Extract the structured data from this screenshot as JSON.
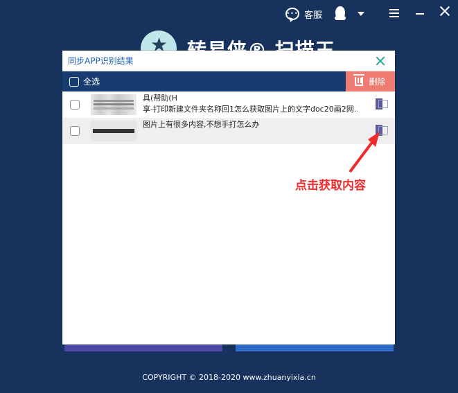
{
  "top_bar": {
    "service_label": "客服"
  },
  "brand": {
    "title": "转易侠® 扫描王"
  },
  "dialog": {
    "title": "同步APP识别结果",
    "select_all_label": "全选",
    "delete_label": "删除",
    "rows": [
      {
        "text_line1": "具(帮助(H",
        "text_line2": "享-打印新建文件夹名称回1怎么获取图片上的文字doc20画2网..."
      },
      {
        "text_line1": "图片上有很多内容,不想手打怎么办",
        "text_line2": ""
      }
    ]
  },
  "annotation": {
    "hint": "点击获取内容"
  },
  "footer": {
    "copyright": "COPYRIGHT © 2018-2020  www.zhuanyixia.cn"
  },
  "colors": {
    "background": "#17325c",
    "toolbar": "#173c72",
    "delete": "#ef7b72",
    "hint": "#ef2b2b"
  },
  "icons": {
    "service": "chat-bubble-icon",
    "qq": "penguin-icon",
    "menu": "menu-icon",
    "minimize": "minimize-icon",
    "close": "close-icon",
    "trash": "trash-icon",
    "action": "import-icon",
    "logo": "logo-icon"
  }
}
